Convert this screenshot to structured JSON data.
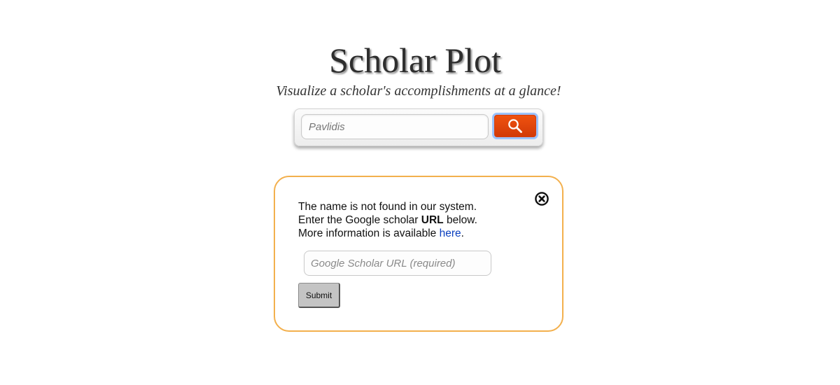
{
  "header": {
    "title": "Scholar Plot",
    "subtitle": "Visualize a scholar's accomplishments at a glance!"
  },
  "search": {
    "value": "",
    "placeholder": "Pavlidis",
    "button_icon": "search-icon",
    "button_color": "#e8480c"
  },
  "dialog": {
    "close_icon": "close-icon",
    "border_color": "#f3b04d",
    "line1": "The name is not found in our system.",
    "line2_prefix": "Enter the Google scholar ",
    "line2_bold": "URL",
    "line2_suffix": " below.",
    "line3_prefix": "More information is available ",
    "line3_link": "here",
    "line3_suffix": ".",
    "url_placeholder": "Google Scholar URL (required)",
    "submit_label": "Submit"
  }
}
